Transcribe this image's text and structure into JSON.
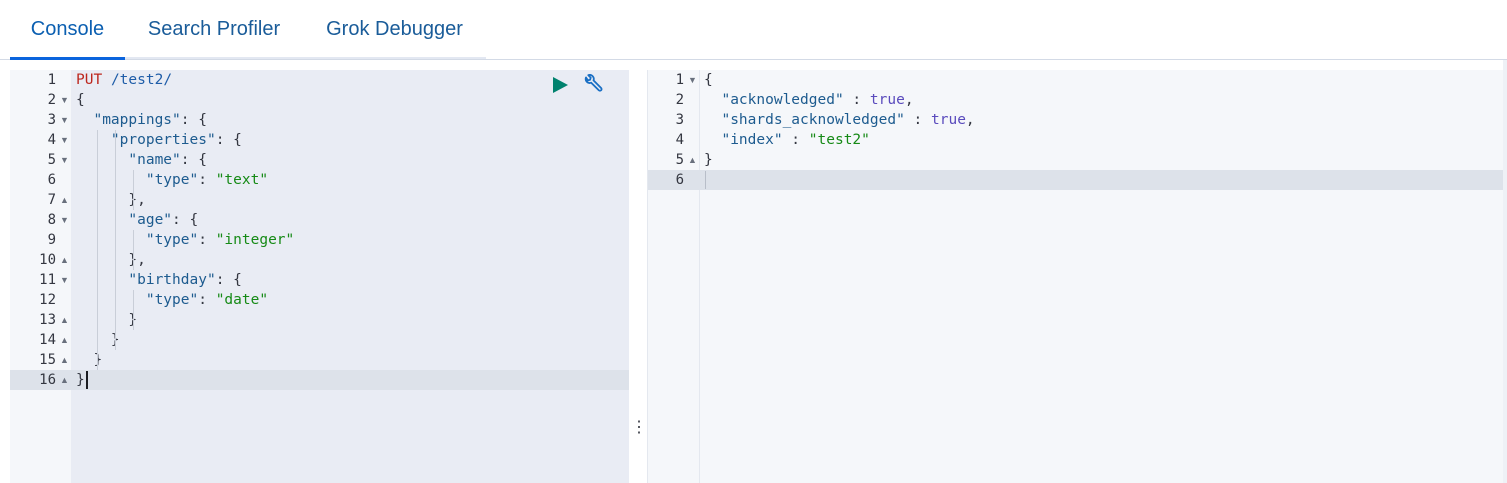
{
  "tabs": [
    {
      "label": "Console",
      "active": true
    },
    {
      "label": "Search Profiler",
      "active": false
    },
    {
      "label": "Grok Debugger",
      "active": false
    }
  ],
  "request_editor": {
    "lines": [
      {
        "n": "1",
        "text": [
          [
            "tok-method",
            "PUT"
          ],
          [
            "tok-punc",
            " "
          ],
          [
            "tok-path",
            "/test2/"
          ]
        ]
      },
      {
        "n": "2",
        "text": [
          [
            "tok-punc",
            "{"
          ]
        ]
      },
      {
        "n": "3",
        "text": [
          [
            "tok-punc",
            "  "
          ],
          [
            "tok-key",
            "\"mappings\""
          ],
          [
            "tok-punc",
            ": {"
          ]
        ]
      },
      {
        "n": "4",
        "text": [
          [
            "tok-punc",
            "    "
          ],
          [
            "tok-key",
            "\"properties\""
          ],
          [
            "tok-punc",
            ": {"
          ]
        ]
      },
      {
        "n": "5",
        "text": [
          [
            "tok-punc",
            "      "
          ],
          [
            "tok-key",
            "\"name\""
          ],
          [
            "tok-punc",
            ": {"
          ]
        ]
      },
      {
        "n": "6",
        "text": [
          [
            "tok-punc",
            "        "
          ],
          [
            "tok-key",
            "\"type\""
          ],
          [
            "tok-punc",
            ": "
          ],
          [
            "tok-str",
            "\"text\""
          ]
        ]
      },
      {
        "n": "7",
        "text": [
          [
            "tok-punc",
            "      },"
          ]
        ]
      },
      {
        "n": "8",
        "text": [
          [
            "tok-punc",
            "      "
          ],
          [
            "tok-key",
            "\"age\""
          ],
          [
            "tok-punc",
            ": {"
          ]
        ]
      },
      {
        "n": "9",
        "text": [
          [
            "tok-punc",
            "        "
          ],
          [
            "tok-key",
            "\"type\""
          ],
          [
            "tok-punc",
            ": "
          ],
          [
            "tok-str",
            "\"integer\""
          ]
        ]
      },
      {
        "n": "10",
        "text": [
          [
            "tok-punc",
            "      },"
          ]
        ]
      },
      {
        "n": "11",
        "text": [
          [
            "tok-punc",
            "      "
          ],
          [
            "tok-key",
            "\"birthday\""
          ],
          [
            "tok-punc",
            ": {"
          ]
        ]
      },
      {
        "n": "12",
        "text": [
          [
            "tok-punc",
            "        "
          ],
          [
            "tok-key",
            "\"type\""
          ],
          [
            "tok-punc",
            ": "
          ],
          [
            "tok-str",
            "\"date\""
          ]
        ]
      },
      {
        "n": "13",
        "text": [
          [
            "tok-punc",
            "      }"
          ]
        ]
      },
      {
        "n": "14",
        "text": [
          [
            "tok-punc",
            "    }"
          ]
        ]
      },
      {
        "n": "15",
        "text": [
          [
            "tok-punc",
            "  }"
          ]
        ]
      },
      {
        "n": "16",
        "text": [
          [
            "tok-punc",
            "}"
          ]
        ]
      }
    ],
    "fold_markers": {
      "2": "down",
      "3": "down",
      "4": "down",
      "5": "down",
      "7": "up",
      "8": "down",
      "10": "up",
      "11": "down",
      "13": "up",
      "14": "up",
      "15": "up",
      "16": "up"
    },
    "active_line": "16",
    "play_icon": "play-icon",
    "wrench_icon": "wrench-icon"
  },
  "response_editor": {
    "lines": [
      {
        "n": "1",
        "text": [
          [
            "tok-punc",
            "{"
          ]
        ]
      },
      {
        "n": "2",
        "text": [
          [
            "tok-punc",
            "  "
          ],
          [
            "tok-key",
            "\"acknowledged\""
          ],
          [
            "tok-punc",
            " : "
          ],
          [
            "tok-bool",
            "true"
          ],
          [
            "tok-punc",
            ","
          ]
        ]
      },
      {
        "n": "3",
        "text": [
          [
            "tok-punc",
            "  "
          ],
          [
            "tok-key",
            "\"shards_acknowledged\""
          ],
          [
            "tok-punc",
            " : "
          ],
          [
            "tok-bool",
            "true"
          ],
          [
            "tok-punc",
            ","
          ]
        ]
      },
      {
        "n": "4",
        "text": [
          [
            "tok-punc",
            "  "
          ],
          [
            "tok-key",
            "\"index\""
          ],
          [
            "tok-punc",
            " : "
          ],
          [
            "tok-str",
            "\"test2\""
          ]
        ]
      },
      {
        "n": "5",
        "text": [
          [
            "tok-punc",
            "}"
          ]
        ]
      },
      {
        "n": "6",
        "text": []
      }
    ],
    "fold_markers": {
      "1": "down",
      "5": "up"
    },
    "active_line": "6"
  },
  "resizer_glyph": "⋮",
  "colors": {
    "accent": "#0b64dd",
    "active_line": "#dde2ea",
    "gutter": "#f5f7fa"
  }
}
